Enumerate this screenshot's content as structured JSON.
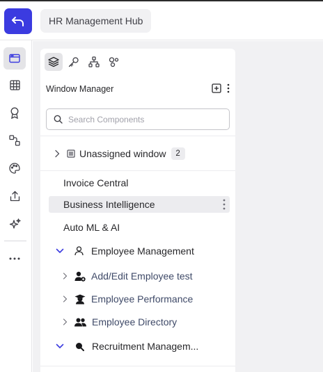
{
  "header": {
    "app_title": "HR Management Hub"
  },
  "panel": {
    "title": "Window Manager",
    "search": {
      "placeholder": "Search Components",
      "value": ""
    },
    "unassigned": {
      "label": "Unassigned window",
      "count": "2"
    },
    "items": [
      {
        "label": "Invoice Central"
      },
      {
        "label": "Business Intelligence"
      },
      {
        "label": "Auto ML & AI"
      }
    ],
    "groups": [
      {
        "label": "Employee Management",
        "children": [
          "Add/Edit Employee test",
          "Employee Performance",
          "Employee Directory"
        ]
      },
      {
        "label": "Recruitment Managem..."
      }
    ]
  },
  "icons": {
    "rail": [
      "window-icon",
      "table-icon",
      "award-icon",
      "flow-icon",
      "palette-icon",
      "upload-icon",
      "sparkles-icon",
      "more-icon"
    ],
    "tabs": [
      "layers-icon",
      "key-icon",
      "hierarchy-icon",
      "shapes-icon"
    ]
  },
  "colors": {
    "accent": "#3b3be0",
    "workspace": "#f1f1f3",
    "highlight": "#ececef",
    "chevron": "#3b3be0"
  }
}
